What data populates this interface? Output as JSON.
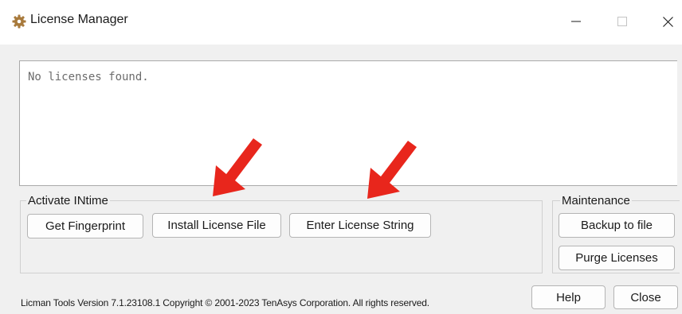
{
  "window": {
    "title": "License Manager",
    "icon": "gear-icon",
    "controls": [
      "minimize-icon",
      "maximize-icon",
      "close-icon"
    ]
  },
  "license_list": {
    "text": "No licenses found."
  },
  "activate_group": {
    "label": "Activate INtime",
    "buttons": {
      "fingerprint": "Get Fingerprint",
      "install": "Install License File",
      "enter": "Enter License String"
    }
  },
  "maintenance_group": {
    "label": "Maintenance",
    "buttons": {
      "backup": "Backup to file",
      "purge": "Purge Licenses"
    }
  },
  "footer": {
    "version_text": "Licman Tools Version 7.1.23108.1 Copyright © 2001-2023 TenAsys Corporation. All rights reserved.",
    "help_label": "Help",
    "close_label": "Close"
  },
  "colors": {
    "annotation_arrow": "#e8261c",
    "window_background": "#f0f0f0",
    "titlebar": "#ffffff"
  }
}
